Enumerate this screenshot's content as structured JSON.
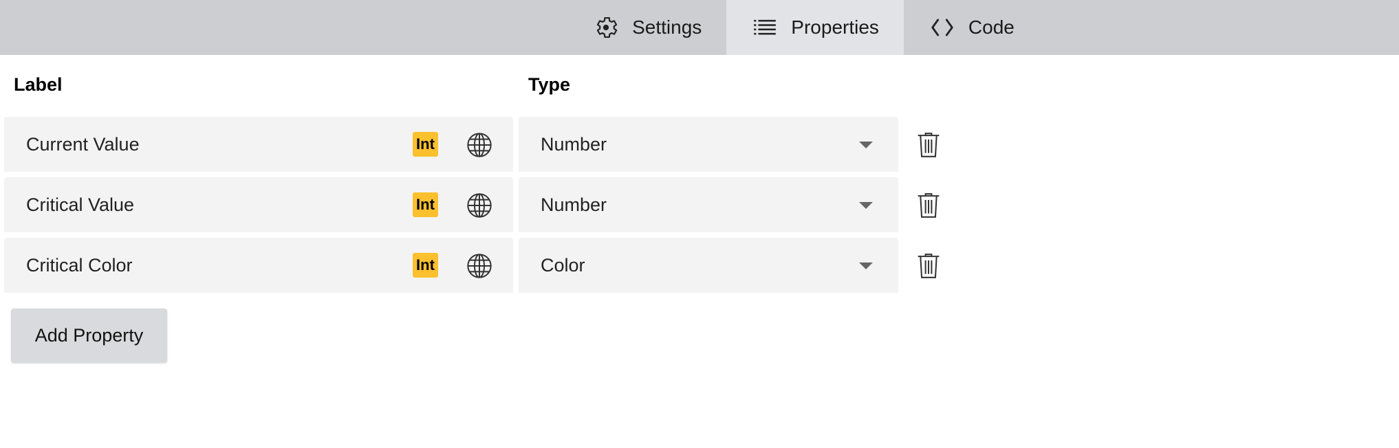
{
  "tabs": [
    {
      "label": "Settings",
      "icon": "gear-icon",
      "active": false
    },
    {
      "label": "Properties",
      "icon": "list-icon",
      "active": true
    },
    {
      "label": "Code",
      "icon": "code-icon",
      "active": false
    }
  ],
  "columns": {
    "label": "Label",
    "type": "Type"
  },
  "properties": [
    {
      "label": "Current Value",
      "badge": "Int",
      "type": "Number"
    },
    {
      "label": "Critical Value",
      "badge": "Int",
      "type": "Number"
    },
    {
      "label": "Critical Color",
      "badge": "Int",
      "type": "Color"
    }
  ],
  "add_button_label": "Add Property",
  "colors": {
    "tabbar_bg": "#cdced2",
    "active_tab_bg": "#e2e3e6",
    "badge_bg": "#fbc02d",
    "field_bg": "#f3f3f3"
  }
}
